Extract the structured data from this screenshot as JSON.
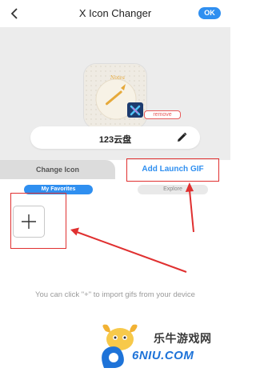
{
  "header": {
    "back_icon": "chevron-left-icon",
    "title": "X Icon Changer",
    "ok_label": "OK"
  },
  "preview": {
    "icon_caption": "Notes",
    "badge_icon": "x-icon-changer-icon",
    "remove_label": "remove",
    "app_name": "123云盘",
    "edit_icon": "pencil-icon"
  },
  "tabs": {
    "change_icon": "Change Icon",
    "add_launch_gif": "Add Launch GIF",
    "active": "add_launch_gif"
  },
  "subtabs": {
    "my_favorites": "My Favorites",
    "explore": "Explore",
    "active": "my_favorites"
  },
  "gif_area": {
    "add_icon": "plus-icon",
    "hint": "You can click \"+\" to import gifs from your device"
  },
  "watermark": {
    "cn_text": "乐牛游戏网",
    "logo_text": "6NIU.COM"
  },
  "colors": {
    "accent": "#2f8ff0",
    "annotation_red": "#e03030",
    "hero_bg": "#ececec"
  }
}
